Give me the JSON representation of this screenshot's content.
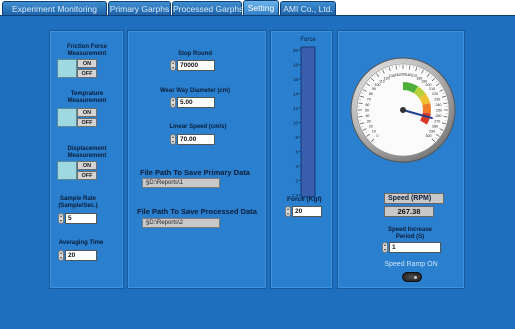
{
  "tabs": [
    {
      "label": "Experiment Monitoring"
    },
    {
      "label": "Primary Garphs"
    },
    {
      "label": "Processed Garphs"
    },
    {
      "label": "Setting"
    },
    {
      "label": "AMI Co., Ltd."
    }
  ],
  "active_tab": "Setting",
  "left": {
    "friction_label": "Friction Force Measurement",
    "temperature_label": "Temprature Measurement",
    "displacement_label": "Displacement Measurement",
    "on_label": "ON",
    "off_label": "OFF",
    "sample_rate_label": "Sample Rate (Sample/Sec.)",
    "sample_rate_value": "5",
    "averaging_label": "Averaging Time",
    "averaging_value": "20"
  },
  "middle": {
    "stop_round_label": "Stop Round",
    "stop_round_value": "70000",
    "wear_way_label": "Wear Way Diameter (cm)",
    "wear_way_value": "5.00",
    "linear_speed_label": "Linear Speed (cm/s)",
    "linear_speed_value": "70.00",
    "primary_path_label": "File Path To Save Primary Data",
    "primary_path_value": "§D:\\Reports\\1",
    "processed_path_label": "File Path To Save Processed Data",
    "processed_path_value": "§D:\\Reports\\2"
  },
  "force": {
    "title": "Force",
    "ticks": [
      "20",
      "18",
      "16",
      "14",
      "12",
      "10",
      "8",
      "6",
      "4",
      "2",
      "1.3"
    ],
    "fill_fraction": 1.0,
    "label": "Force (Kgf)",
    "value": "20"
  },
  "speed": {
    "gauge_ticks": [
      "0",
      "10",
      "20",
      "30",
      "40",
      "50",
      "60",
      "70",
      "80",
      "90",
      "100",
      "110",
      "120",
      "130",
      "140",
      "150",
      "160",
      "170",
      "180",
      "190",
      "200",
      "210",
      "220",
      "230",
      "240",
      "250",
      "260",
      "270",
      "280",
      "290",
      "300"
    ],
    "gauge_value": 267.38,
    "gauge_min": 0,
    "gauge_max": 300,
    "readout_label": "Speed (RPM)",
    "readout_value": "267.38",
    "increase_label": "Speed Increase Period (S)",
    "increase_value": "1",
    "ramp_label": "Speed Ramp ON"
  },
  "colors": {
    "background": "#1e6fbe",
    "panel": "#2a80cf",
    "force_bar": "#3a5fae"
  }
}
